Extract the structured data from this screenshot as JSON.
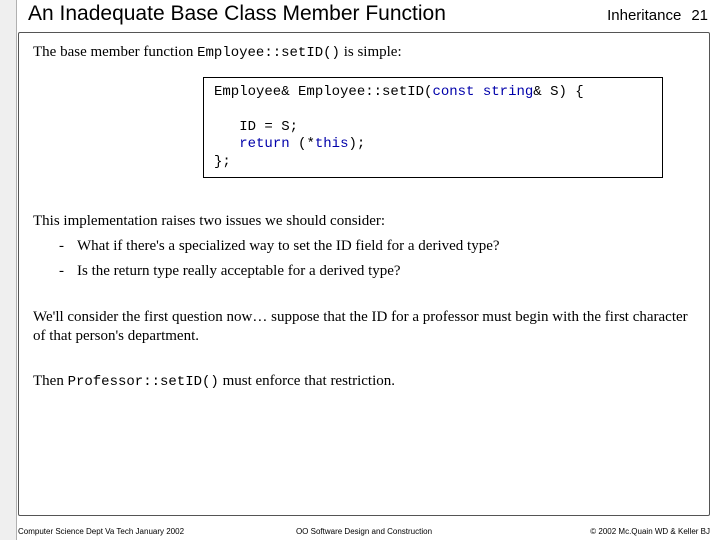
{
  "header": {
    "title": "An Inadequate Base Class Member Function",
    "section": "Inheritance",
    "page": "21"
  },
  "body": {
    "intro_prefix": "The base member function ",
    "intro_code": "Employee::setID()",
    "intro_suffix": " is simple:",
    "code": {
      "sig_left": "Employee& Employee::setID(",
      "sig_kw1": "const",
      "sig_mid": " ",
      "sig_kw2": "string",
      "sig_right": "& S) {",
      "line1_indent": "   ",
      "line1": "ID = S;",
      "line2_indent": "   ",
      "line2_kw": "return",
      "line2_rest": " (*",
      "line2_kw2": "this",
      "line2_tail": ");",
      "close": "};"
    },
    "issues_intro": "This implementation raises two issues we should consider:",
    "bullet1": "What if there's a specialized way to set the ID field for a derived type?",
    "bullet2": "Is the return type really acceptable for a derived type?",
    "para1": "We'll consider the first question now… suppose that the ID for a professor must begin with the first character of that person's department.",
    "para2_prefix": "Then ",
    "para2_code": "Professor::setID()",
    "para2_suffix": " must enforce that restriction."
  },
  "footer": {
    "left": "Computer Science Dept Va Tech January 2002",
    "center": "OO Software Design and Construction",
    "right": "© 2002 Mc.Quain WD & Keller BJ"
  }
}
